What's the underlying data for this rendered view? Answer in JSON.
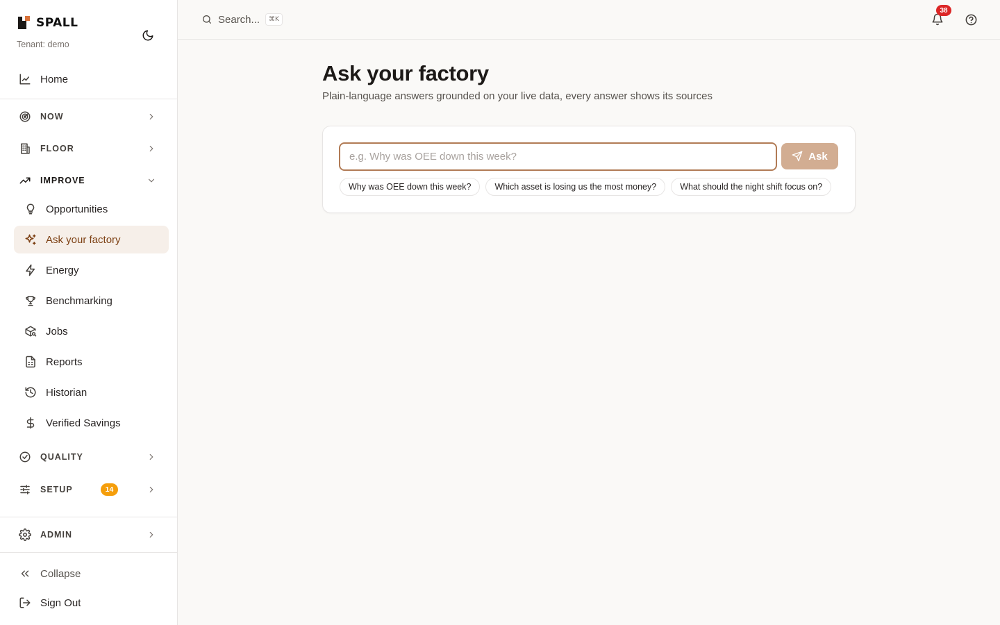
{
  "brand": {
    "name": "SPALL",
    "tenant": "Tenant: demo"
  },
  "sidebar": {
    "home": {
      "label": "Home",
      "icon": "factory-chart-icon"
    },
    "sections": {
      "now": {
        "label": "NOW",
        "icon": "radar-icon"
      },
      "floor": {
        "label": "FLOOR",
        "icon": "building-icon"
      },
      "improve": {
        "label": "IMPROVE",
        "icon": "trending-up-icon",
        "items": [
          {
            "label": "Opportunities",
            "icon": "lightbulb-icon"
          },
          {
            "label": "Ask your factory",
            "icon": "sparkles-icon",
            "active": true
          },
          {
            "label": "Energy",
            "icon": "bolt-icon"
          },
          {
            "label": "Benchmarking",
            "icon": "trophy-icon"
          },
          {
            "label": "Jobs",
            "icon": "package-search-icon"
          },
          {
            "label": "Reports",
            "icon": "spreadsheet-icon"
          },
          {
            "label": "Historian",
            "icon": "history-icon"
          },
          {
            "label": "Verified Savings",
            "icon": "dollar-icon"
          }
        ]
      },
      "quality": {
        "label": "QUALITY",
        "icon": "check-circle-icon"
      },
      "setup": {
        "label": "SETUP",
        "icon": "sliders-icon",
        "badge": "14"
      },
      "admin": {
        "label": "ADMIN",
        "icon": "gear-icon"
      }
    },
    "collapse": {
      "label": "Collapse"
    },
    "signout": {
      "label": "Sign Out"
    }
  },
  "topbar": {
    "search_label": "Search...",
    "search_shortcut": "⌘K",
    "notifications_count": "38"
  },
  "main": {
    "title": "Ask your factory",
    "subtitle": "Plain-language answers grounded on your live data, every answer shows its sources",
    "input_placeholder": "e.g. Why was OEE down this week?",
    "ask_label": "Ask",
    "suggestions": [
      "Why was OEE down this week?",
      "Which asset is losing us the most money?",
      "What should the night shift focus on?"
    ]
  },
  "colors": {
    "accent": "#b17b55",
    "active_bg": "#f6efe9",
    "active_text": "#7c3f12",
    "button_bg": "#d2ad92",
    "badge_orange": "#f59e0b",
    "badge_red": "#dc2626"
  }
}
